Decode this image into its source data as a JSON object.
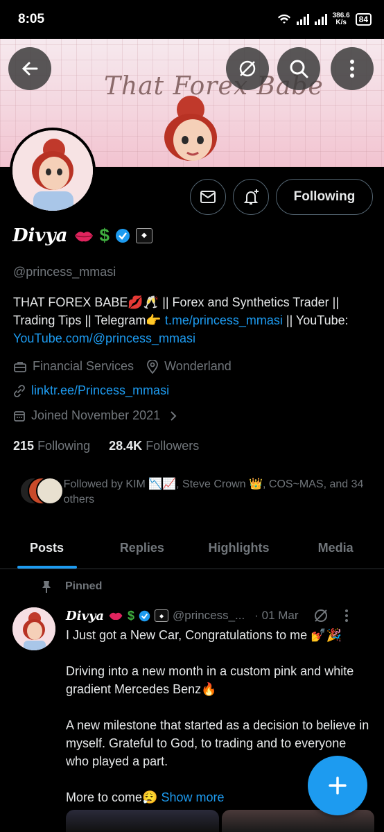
{
  "status_bar": {
    "time": "8:05",
    "net_speed": "386.6",
    "net_unit": "K/s",
    "battery": "84"
  },
  "banner": {
    "title": "That Forex Babe"
  },
  "profile": {
    "name": "Divya",
    "handle": "@princess_mmasi",
    "follow_button": "Following",
    "bio_text1": "THAT FOREX BABE💋🥂 || Forex and Synthetics Trader || Trading Tips || Telegram👉 ",
    "bio_link1": "t.me/princess_mmasi",
    "bio_text2": " || YouTube: ",
    "bio_link2": "YouTube.com/@princess_mmasi",
    "category": "Financial Services",
    "location": "Wonderland",
    "website": "linktr.ee/Princess_mmasi",
    "joined": "Joined November 2021",
    "following_count": "215",
    "following_label": "Following",
    "followers_count": "28.4K",
    "followers_label": "Followers",
    "followed_by": "Followed by KIM 📉📈, Steve Crown 👑, COS~MAS, and 34 others"
  },
  "tabs": [
    "Posts",
    "Replies",
    "Highlights",
    "Media"
  ],
  "post": {
    "pinned_label": "Pinned",
    "name": "Divya",
    "handle": "@princess_...",
    "date": "· 01 Mar",
    "para1": "I Just got a New Car, Congratulations to me 💅🎉",
    "para2": "Driving into a new month in a custom pink and white gradient Mercedes Benz🔥",
    "para3": "A new milestone that started as a decision to believe in myself. Grateful to God, to trading and to everyone who played a part.",
    "para4": "More to come😮‍💨 ",
    "show_more": "Show more"
  },
  "colors": {
    "accent": "#1d9bf0",
    "muted": "#71767b",
    "text": "#e7e9ea"
  }
}
